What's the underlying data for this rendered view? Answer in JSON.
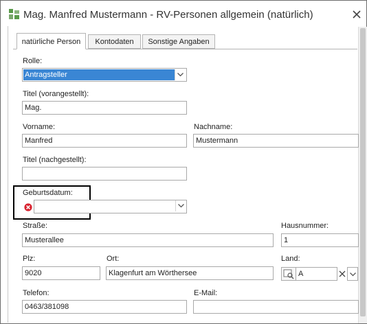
{
  "window": {
    "title": "Mag. Manfred Mustermann - RV-Personen allgemein (natürlich)"
  },
  "tabs": [
    {
      "label": "natürliche Person",
      "active": true
    },
    {
      "label": "Kontodaten",
      "active": false
    },
    {
      "label": "Sonstige Angaben",
      "active": false
    }
  ],
  "form": {
    "rolle": {
      "label": "Rolle:",
      "value": "Antragsteller"
    },
    "titel_vor": {
      "label": "Titel (vorangestellt):",
      "value": "Mag."
    },
    "vorname": {
      "label": "Vorname:",
      "value": "Manfred"
    },
    "nachname": {
      "label": "Nachname:",
      "value": "Mustermann"
    },
    "titel_nach": {
      "label": "Titel (nachgestellt):",
      "value": ""
    },
    "geburtsdatum": {
      "label": "Geburtsdatum:",
      "value": "",
      "status": "error"
    },
    "strasse": {
      "label": "Straße:",
      "value": "Musterallee"
    },
    "hausnummer": {
      "label": "Hausnummer:",
      "value": "1"
    },
    "plz": {
      "label": "Plz:",
      "value": "9020"
    },
    "ort": {
      "label": "Ort:",
      "value": "Klagenfurt am Wörthersee"
    },
    "land": {
      "label": "Land:",
      "value": "A"
    },
    "telefon": {
      "label": "Telefon:",
      "value": "0463/381098"
    },
    "email": {
      "label": "E-Mail:",
      "value": ""
    }
  },
  "icons": {
    "app": "app-icon",
    "close": "close-icon",
    "error": "error-icon",
    "dropdown": "chevron-down-icon",
    "lookup": "lookup-icon",
    "clear": "clear-icon"
  },
  "colors": {
    "selection": "#3a86d4",
    "error": "#d9232f",
    "app_icon_green": "#5a9a4a"
  }
}
